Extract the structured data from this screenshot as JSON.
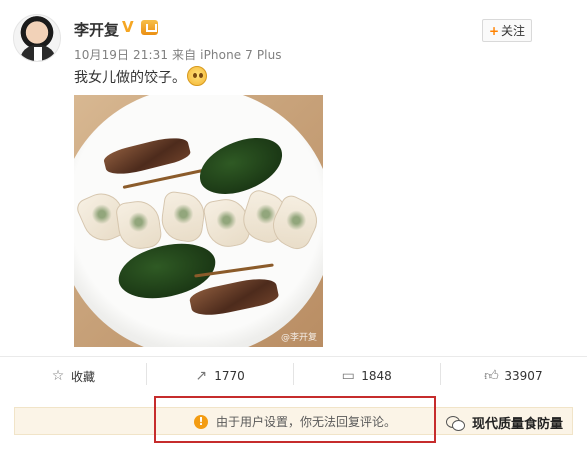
{
  "post": {
    "author": "李开复",
    "verified_badge": "V",
    "member_icon": "member-badge-icon",
    "meta": "10月19日 21:31 来自 iPhone 7 Plus",
    "follow_button": "关注",
    "follow_plus": "+",
    "text": "我女儿做的饺子。",
    "emoji": "blushing-face-emoji",
    "image_watermark": "@李开复"
  },
  "actions": {
    "favorite_label": "收藏",
    "repost_count": "1770",
    "comment_count": "1848",
    "like_count": "33907"
  },
  "notice": {
    "text": "由于用户设置，你无法回复评论。",
    "icon": "warning-icon",
    "highlight_color": "#c62c2c"
  },
  "source": {
    "label": "现代质量食防量",
    "icon": "wechat-icon"
  },
  "colors": {
    "accent": "#ff8200",
    "badge": "#f5a623",
    "notice_bg": "#fbf4e7"
  }
}
